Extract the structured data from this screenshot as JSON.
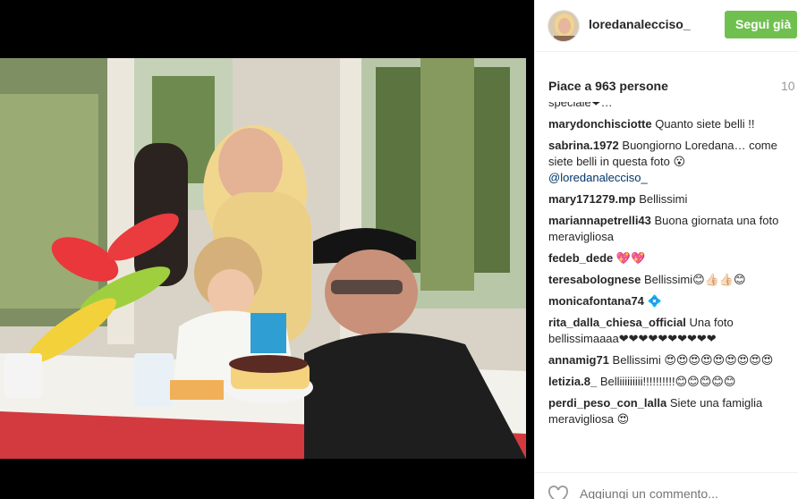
{
  "post": {
    "username": "loredanalecciso_",
    "follow_label": "Segui già",
    "likes_text": "Piace a 963 persone",
    "timestamp": "10"
  },
  "comments": [
    {
      "user": "",
      "text": "speciale❤…"
    },
    {
      "user": "marydonchisciotte",
      "text": "Quanto siete belli !!"
    },
    {
      "user": "sabrina.1972",
      "text": "Buongiorno Loredana… come siete belli in questa foto 😮",
      "mention": "@loredanalecciso_"
    },
    {
      "user": "mary171279.mp",
      "text": "Bellissimi"
    },
    {
      "user": "mariannapetrelli43",
      "text": "Buona giornata una foto meravigliosa"
    },
    {
      "user": "fedeb_dede",
      "text": "💖💖"
    },
    {
      "user": "teresabolognese",
      "text": "Bellissimi😊👍🏻👍🏻😊"
    },
    {
      "user": "monicafontana74",
      "text": "💠"
    },
    {
      "user": "rita_dalla_chiesa_official",
      "text": "Una foto bellissimaaaa❤❤❤❤❤❤❤❤❤❤"
    },
    {
      "user": "annamig71",
      "text": "Bellissimi 😍😍😍😍😍😍😍😍😍"
    },
    {
      "user": "letizia.8_",
      "text": "Belliiiiiiiii!!!!!!!!!!😊😊😊😊😊"
    },
    {
      "user": "perdi_peso_con_lalla",
      "text": "Siete una famiglia meravigliosa 😍"
    }
  ],
  "add_comment": {
    "placeholder": "Aggiungi un commento..."
  },
  "icons": {
    "like": "heart-icon"
  },
  "colors": {
    "follow_button": "#70c050",
    "mention": "#003569"
  }
}
